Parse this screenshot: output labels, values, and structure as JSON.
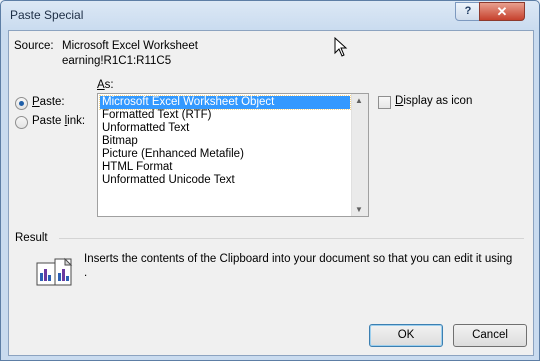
{
  "window": {
    "title": "Paste Special"
  },
  "titlebar": {
    "help_label": "?",
    "close_label": "✕"
  },
  "source": {
    "label": "Source:",
    "line1": "Microsoft Excel Worksheet",
    "line2": "earning!R1C1:R11C5"
  },
  "as_label": "As:",
  "options": {
    "paste": {
      "label": "Paste:",
      "checked": true
    },
    "paste_link": {
      "label": "Paste link:",
      "checked": false
    }
  },
  "formats": [
    "Microsoft Excel Worksheet Object",
    "Formatted Text (RTF)",
    "Unformatted Text",
    "Bitmap",
    "Picture (Enhanced Metafile)",
    "HTML Format",
    "Unformatted Unicode Text"
  ],
  "selected_format_index": 0,
  "display_as_icon": {
    "label": "Display as icon",
    "checked": false
  },
  "result": {
    "label": "Result",
    "text_line1": "Inserts the contents of the Clipboard into your document so that you can edit it using",
    "text_line2": "."
  },
  "buttons": {
    "ok": "OK",
    "cancel": "Cancel"
  },
  "icons": {
    "result": "paste-clipboard-icon",
    "cursor": "mouse-pointer-icon"
  },
  "colors": {
    "selection": "#3399ff",
    "titlebar": "#c9dbef",
    "close_button": "#c6412d"
  }
}
